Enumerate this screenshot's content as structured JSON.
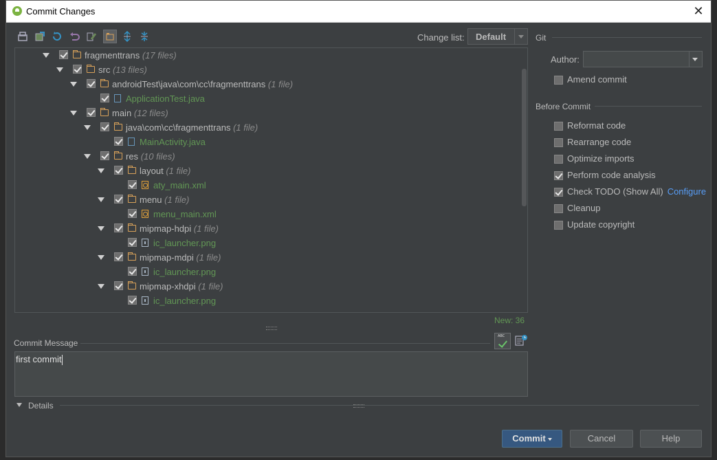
{
  "window": {
    "title": "Commit Changes",
    "close_label": "✕"
  },
  "toolbar": {
    "buttons": [
      "show-diff-icon",
      "move-to-changelist-icon",
      "refresh-icon",
      "rollback-icon",
      "edit-source-icon",
      "group-by-directory-icon",
      "expand-all-icon",
      "collapse-all-icon"
    ]
  },
  "changelist": {
    "label": "Change list:",
    "value": "Default"
  },
  "tree": {
    "rows": [
      {
        "depth": 0,
        "type": "folder",
        "name": "fragmenttrans",
        "count": "(17 files)"
      },
      {
        "depth": 1,
        "type": "folder",
        "name": "src",
        "count": "(13 files)"
      },
      {
        "depth": 2,
        "type": "folder",
        "name": "androidTest\\java\\com\\cc\\fragmenttrans",
        "count": "(1 file)"
      },
      {
        "depth": 3,
        "type": "java",
        "name": "ApplicationTest.java",
        "count": ""
      },
      {
        "depth": 2,
        "type": "folder",
        "name": "main",
        "count": "(12 files)"
      },
      {
        "depth": 3,
        "type": "folder",
        "name": "java\\com\\cc\\fragmenttrans",
        "count": "(1 file)"
      },
      {
        "depth": 4,
        "type": "java",
        "name": "MainActivity.java",
        "count": ""
      },
      {
        "depth": 3,
        "type": "folder",
        "name": "res",
        "count": "(10 files)"
      },
      {
        "depth": 4,
        "type": "folder",
        "name": "layout",
        "count": "(1 file)"
      },
      {
        "depth": 5,
        "type": "xml",
        "name": "aty_main.xml",
        "count": ""
      },
      {
        "depth": 4,
        "type": "folder",
        "name": "menu",
        "count": "(1 file)"
      },
      {
        "depth": 5,
        "type": "xml",
        "name": "menu_main.xml",
        "count": ""
      },
      {
        "depth": 4,
        "type": "folder",
        "name": "mipmap-hdpi",
        "count": "(1 file)"
      },
      {
        "depth": 5,
        "type": "png",
        "name": "ic_launcher.png",
        "count": ""
      },
      {
        "depth": 4,
        "type": "folder",
        "name": "mipmap-mdpi",
        "count": "(1 file)"
      },
      {
        "depth": 5,
        "type": "png",
        "name": "ic_launcher.png",
        "count": ""
      },
      {
        "depth": 4,
        "type": "folder",
        "name": "mipmap-xhdpi",
        "count": "(1 file)"
      },
      {
        "depth": 5,
        "type": "png",
        "name": "ic_launcher.png",
        "count": ""
      }
    ],
    "new_count": "New: 36"
  },
  "commit_message": {
    "label": "Commit Message",
    "text": "first commit"
  },
  "details": {
    "label": "Details"
  },
  "git": {
    "section": "Git",
    "author_label": "Author:",
    "author_value": "",
    "amend": {
      "label": "Amend commit",
      "checked": false
    }
  },
  "before_commit": {
    "section": "Before Commit",
    "options": [
      {
        "label": "Reformat code",
        "checked": false
      },
      {
        "label": "Rearrange code",
        "checked": false
      },
      {
        "label": "Optimize imports",
        "checked": false
      },
      {
        "label": "Perform code analysis",
        "checked": true
      },
      {
        "label": "Check TODO (Show All)",
        "checked": true,
        "link": "Configure"
      },
      {
        "label": "Cleanup",
        "checked": false
      },
      {
        "label": "Update copyright",
        "checked": false
      }
    ]
  },
  "buttons": {
    "commit": "Commit",
    "cancel": "Cancel",
    "help": "Help"
  }
}
